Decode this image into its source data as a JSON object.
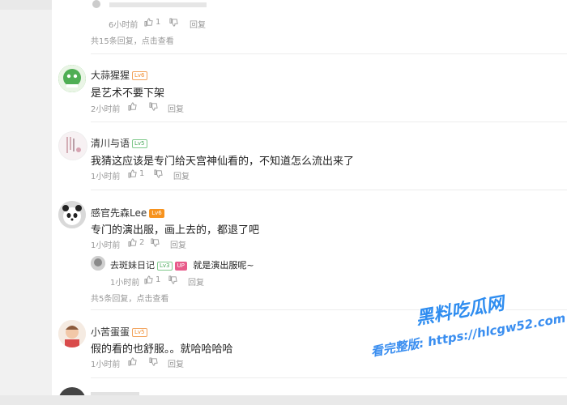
{
  "top_reply": {
    "time": "6小时前",
    "likes": "1",
    "reply_label": "回复",
    "more_text": "共15条回复，点击查看"
  },
  "comments": [
    {
      "name": "大蒜猩猩",
      "badge": "Lv6",
      "text": "是艺术不要下架",
      "time": "2小时前",
      "likes": "",
      "reply_label": "回复"
    },
    {
      "name": "清川与语",
      "badge": "Lv5",
      "text": "我猜这应该是专门给天宫神仙看的，不知道怎么流出来了",
      "time": "1小时前",
      "likes": "1",
      "reply_label": "回复"
    },
    {
      "name": "感官先森Lee",
      "badge": "Lv6",
      "text": "专门的演出服，画上去的，都退了吧",
      "time": "1小时前",
      "likes": "2",
      "reply_label": "回复",
      "reply": {
        "name": "去斑妹日记",
        "badge1": "Lv3",
        "badge2": "UP",
        "text": "就是演出服呢~",
        "time": "1小时前",
        "likes": "1",
        "reply_label": "回复"
      },
      "more_text": "共5条回复，点击查看"
    },
    {
      "name": "小苦蛋蛋",
      "badge": "Lv5",
      "text": "假的看的也舒服。。就哈哈哈哈",
      "time": "1小时前",
      "likes": "",
      "reply_label": "回复"
    }
  ],
  "watermark": {
    "title": "黑料吃瓜网",
    "url": "看完整版: https://hlcgw52.com"
  },
  "colors": {
    "link_blue": "#2f8df0",
    "text_gray": "#999999",
    "divider": "#ececec"
  }
}
